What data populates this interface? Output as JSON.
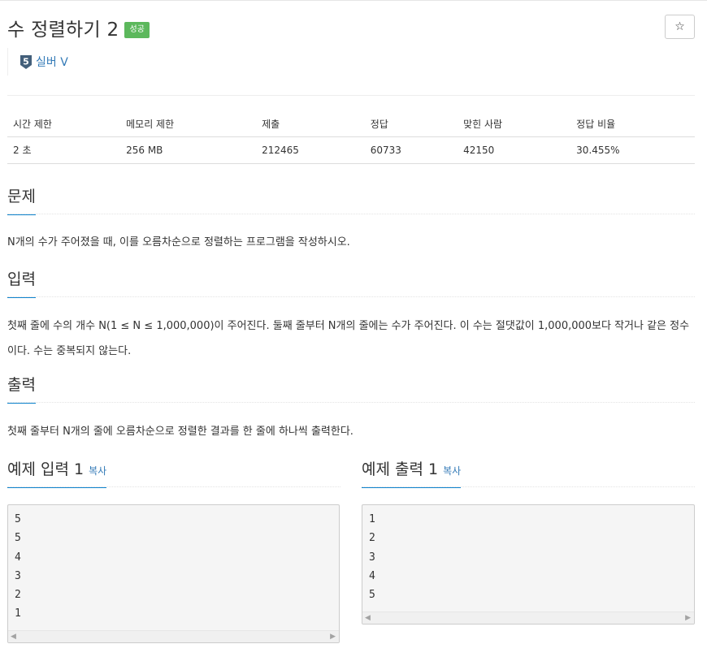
{
  "problem": {
    "title": "수 정렬하기 2",
    "result_label": "성공",
    "star_icon": "☆",
    "tier_number": "5",
    "tier_label": "실버 V"
  },
  "info_table": {
    "headers": [
      "시간 제한",
      "메모리 제한",
      "제출",
      "정답",
      "맞힌 사람",
      "정답 비율"
    ],
    "values": [
      "2 초",
      "256 MB",
      "212465",
      "60733",
      "42150",
      "30.455%"
    ]
  },
  "sections": {
    "problem_heading": "문제",
    "problem_text": "N개의 수가 주어졌을 때, 이를 오름차순으로 정렬하는 프로그램을 작성하시오.",
    "input_heading": "입력",
    "input_text": "첫째 줄에 수의 개수 N(1 ≤ N ≤ 1,000,000)이 주어진다. 둘째 줄부터 N개의 줄에는 수가 주어진다. 이 수는 절댓값이 1,000,000보다 작거나 같은 정수이다. 수는 중복되지 않는다.",
    "output_heading": "출력",
    "output_text": "첫째 줄부터 N개의 줄에 오름차순으로 정렬한 결과를 한 줄에 하나씩 출력한다."
  },
  "samples": {
    "input_heading": "예제 입력 1",
    "output_heading": "예제 출력 1",
    "copy_label": "복사",
    "input_lines": [
      "5",
      "5",
      "4",
      "3",
      "2",
      "1"
    ],
    "output_lines": [
      "1",
      "2",
      "3",
      "4",
      "5"
    ]
  },
  "colors": {
    "accent": "#0e83cd",
    "success": "#5cb85c",
    "link": "#337ab7",
    "tier": "#435f7a"
  }
}
